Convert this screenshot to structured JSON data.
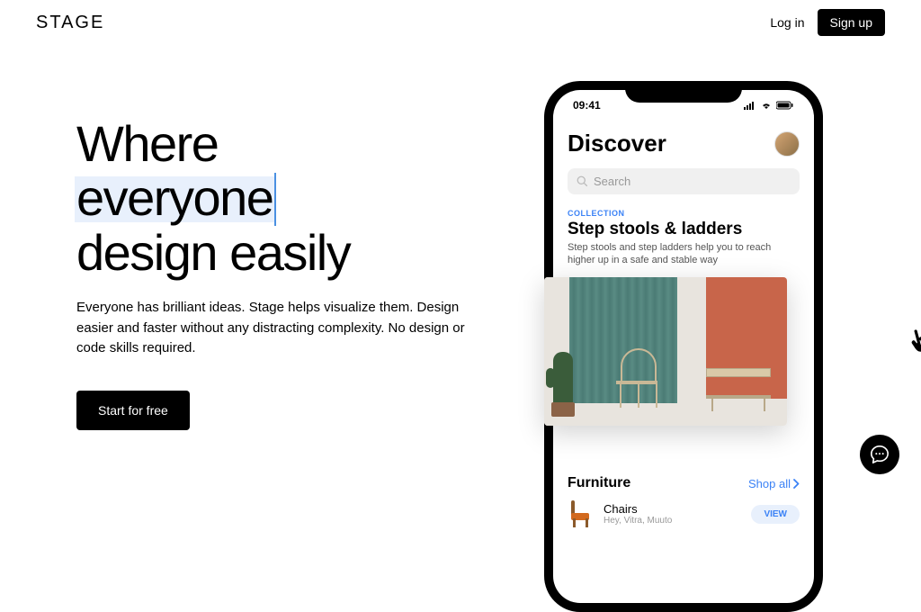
{
  "header": {
    "logo": "STAGE",
    "login": "Log in",
    "signup": "Sign up"
  },
  "hero": {
    "title_line1": "Where",
    "title_highlight": "everyone",
    "title_line3": "design easily",
    "subtitle": "Everyone has brilliant ideas. Stage helps visualize them. Design easier and faster without any distracting complexity. No design or code skills required.",
    "cta": "Start for free"
  },
  "phone": {
    "time": "09:41",
    "discover_title": "Discover",
    "search_placeholder": "Search",
    "collection_label": "COLLECTION",
    "collection_title": "Step stools & ladders",
    "collection_desc": "Step stools and step ladders help you to reach higher up in a safe and stable way",
    "furniture_title": "Furniture",
    "shop_all": "Shop all",
    "item": {
      "title": "Chairs",
      "subtitle": "Hey, Vitra, Muuto",
      "view": "VIEW"
    }
  }
}
